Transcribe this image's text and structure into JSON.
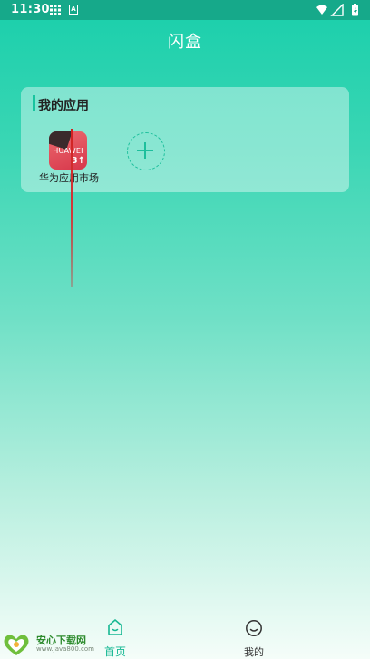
{
  "status_bar": {
    "time": "11:30",
    "a_badge": "A"
  },
  "app": {
    "title": "闪盒"
  },
  "my_apps": {
    "section_title": "我的应用",
    "items": [
      {
        "label": "华为应用市场",
        "icon_text": "HUAWEI",
        "icon_badge": "3↑"
      }
    ],
    "add_icon": "plus-icon"
  },
  "bottom_nav": {
    "home_label": "首页",
    "mine_label": "我的"
  },
  "watermark": {
    "title": "安心下载网",
    "url": "www.java800.com"
  },
  "colors": {
    "accent": "#16b893",
    "status_bar": "#16a98a",
    "pointer": "#d32020"
  }
}
